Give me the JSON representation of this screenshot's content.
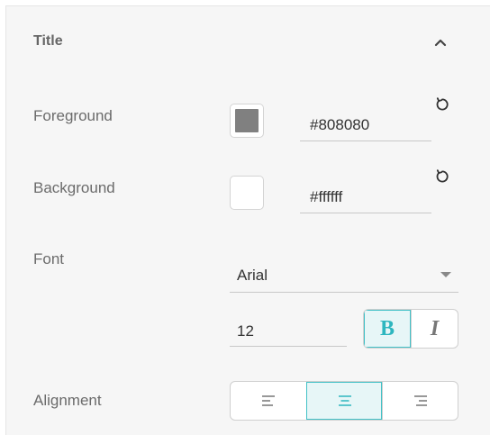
{
  "section": {
    "title": "Title"
  },
  "colors": {
    "accent": "#42c1c7",
    "foreground_swatch": "#808080",
    "background_swatch": "#ffffff"
  },
  "foreground": {
    "label": "Foreground",
    "value": "#808080"
  },
  "background": {
    "label": "Background",
    "value": "#ffffff"
  },
  "font": {
    "label": "Font",
    "family": "Arial",
    "size": "12",
    "bold_label": "B",
    "italic_label": "I",
    "bold_active": true,
    "italic_active": false
  },
  "alignment": {
    "label": "Alignment",
    "options": [
      "left",
      "center",
      "right"
    ],
    "selected": "center"
  },
  "icons": [
    "chevron-up-icon",
    "reset-icon",
    "dropdown-caret-icon",
    "align-left-icon",
    "align-center-icon",
    "align-right-icon"
  ]
}
